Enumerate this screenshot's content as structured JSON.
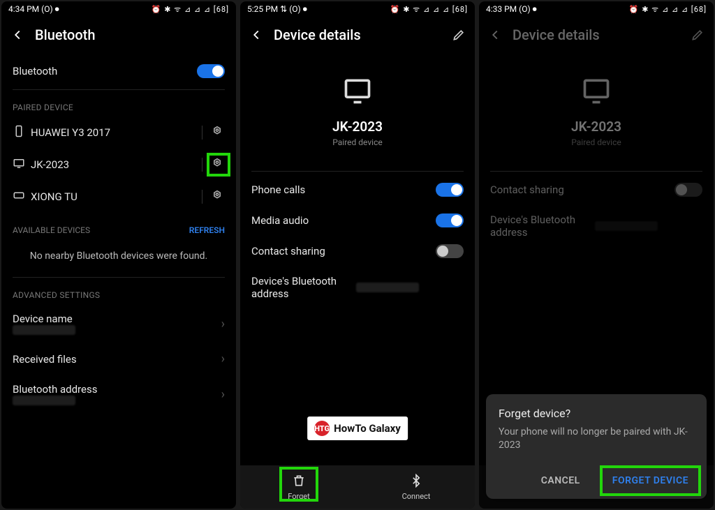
{
  "screen1": {
    "time": "4:34 PM",
    "status_extra": "(O) ⏺",
    "status_right": "⏰ ✱ ᯤ ⊿ ⊿ ⊿ [68]",
    "title": "Bluetooth",
    "bt_label": "Bluetooth",
    "paired_hdr": "PAIRED DEVICE",
    "paired": [
      {
        "name": "HUAWEI Y3 2017",
        "icon": "phone"
      },
      {
        "name": "JK-2023",
        "icon": "display"
      },
      {
        "name": "XIONG TU",
        "icon": "keyboard"
      }
    ],
    "avail_hdr": "AVAILABLE DEVICES",
    "refresh": "REFRESH",
    "empty": "No nearby Bluetooth devices were found.",
    "adv_hdr": "ADVANCED SETTINGS",
    "adv": [
      "Device name",
      "Received files",
      "Bluetooth address"
    ]
  },
  "screen2": {
    "time": "5:25 PM",
    "status_extra": "⇅ (O) ⏺",
    "status_right": "⏰ ✱ ᯤ ⊿ ⊿ ⊿ [68]",
    "title": "Device details",
    "device_name": "JK-2023",
    "device_kind": "Paired device",
    "opts": {
      "phone_calls": "Phone calls",
      "media_audio": "Media audio",
      "contact_sharing": "Contact sharing",
      "bt_addr": "Device's Bluetooth address"
    },
    "forget": "Forget",
    "connect": "Connect",
    "watermark": "HowTo Galaxy"
  },
  "screen3": {
    "time": "4:33 PM",
    "status_extra": "(O) ⏺",
    "status_right": "⏰ ✱ ᯤ ⊿ ⊿ ⊿ [68]",
    "title": "Device details",
    "device_name": "JK-2023",
    "device_kind": "Paired device",
    "contact_sharing": "Contact sharing",
    "bt_addr": "Device's Bluetooth address",
    "dialog_title": "Forget device?",
    "dialog_msg": "Your phone will no longer be paired with JK-2023",
    "cancel": "CANCEL",
    "forget_device": "FORGET DEVICE"
  }
}
